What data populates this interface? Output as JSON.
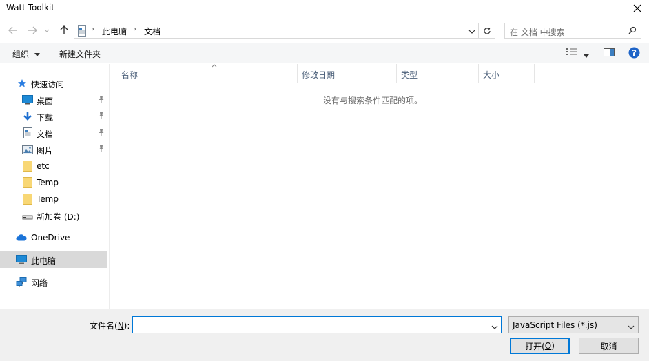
{
  "window": {
    "title": "Watt Toolkit"
  },
  "nav": {
    "breadcrumb": [
      "此电脑",
      "文档"
    ],
    "search_placeholder": "在 文档 中搜索"
  },
  "toolbar": {
    "organize_label": "组织",
    "new_folder_label": "新建文件夹"
  },
  "sidebar": {
    "quick_access_label": "快速访问",
    "quick_items": [
      {
        "label": "桌面",
        "icon": "desktop-icon",
        "pinned": true
      },
      {
        "label": "下载",
        "icon": "download-icon",
        "pinned": true
      },
      {
        "label": "文档",
        "icon": "document-icon",
        "pinned": true
      },
      {
        "label": "图片",
        "icon": "pictures-icon",
        "pinned": true
      },
      {
        "label": "etc",
        "icon": "folder-icon",
        "pinned": false
      },
      {
        "label": "Temp",
        "icon": "folder-icon",
        "pinned": false
      },
      {
        "label": "Temp",
        "icon": "folder-icon",
        "pinned": false
      },
      {
        "label": "新加卷 (D:)",
        "icon": "drive-icon",
        "pinned": false
      }
    ],
    "onedrive_label": "OneDrive",
    "this_pc_label": "此电脑",
    "network_label": "网络"
  },
  "list": {
    "columns": [
      "名称",
      "修改日期",
      "类型",
      "大小"
    ],
    "empty_message": "没有与搜索条件匹配的项。"
  },
  "footer": {
    "filename_label_prefix": "文件名(",
    "filename_label_accel": "N",
    "filename_label_suffix": "):",
    "filename_value": "",
    "filetype_selected": "JavaScript Files (*.js)",
    "open_prefix": "打开(",
    "open_accel": "O",
    "open_suffix": ")",
    "cancel_label": "取消"
  },
  "colors": {
    "accent": "#0078d7",
    "help": "#1e64c8",
    "selected": "#d9d9d9",
    "folder": "#f8d775"
  }
}
